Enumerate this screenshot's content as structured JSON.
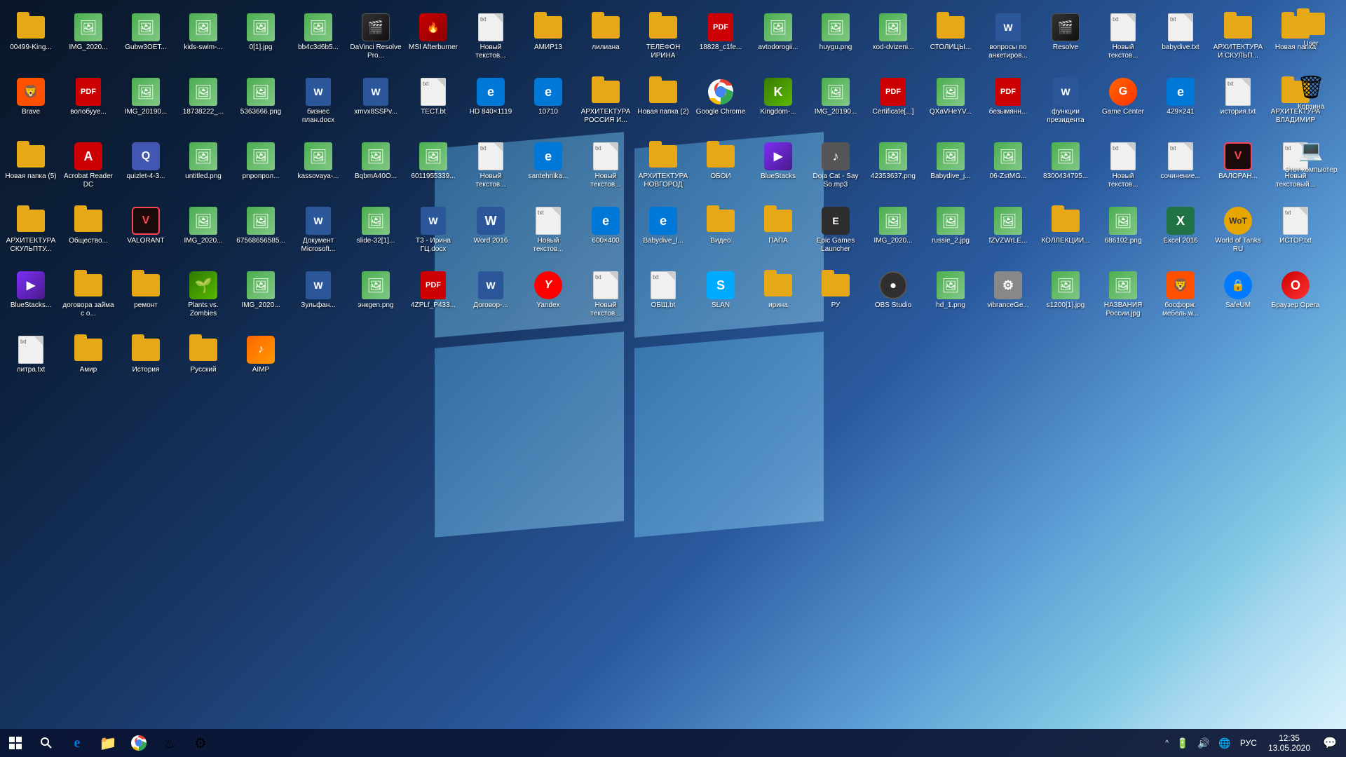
{
  "desktop": {
    "icons": [
      {
        "id": "00499-king",
        "label": "00499-King...",
        "type": "folder",
        "color": "#e6a817"
      },
      {
        "id": "img-2020-1",
        "label": "IMG_2020...",
        "type": "image"
      },
      {
        "id": "gubw3oet",
        "label": "Gubw3OET...",
        "type": "image"
      },
      {
        "id": "kids-swim",
        "label": "kids-swim-...",
        "type": "image"
      },
      {
        "id": "0-1-jpg",
        "label": "0[1].jpg",
        "type": "image"
      },
      {
        "id": "bb4c3d6b5",
        "label": "bb4c3d6b5...",
        "type": "image"
      },
      {
        "id": "davinci",
        "label": "DaVinci Resolve Pro...",
        "type": "app",
        "color": "#222",
        "symbol": "🎬"
      },
      {
        "id": "msi-afterburner",
        "label": "MSI Afterburner",
        "type": "app",
        "color": "#cc0000",
        "symbol": "🔥"
      },
      {
        "id": "novyi-txt-1",
        "label": "Новый текстов...",
        "type": "txt"
      },
      {
        "id": "amir13",
        "label": "АМИР13",
        "type": "folder",
        "color": "#e6a817"
      },
      {
        "id": "liliana",
        "label": "лилиана",
        "type": "folder",
        "color": "#e6a817"
      },
      {
        "id": "telefon-irina",
        "label": "ТЕЛЕФОН ИРИНА",
        "type": "folder",
        "color": "#e6a817"
      },
      {
        "id": "18828-c1fe",
        "label": "18828_c1fe...",
        "type": "pdf"
      },
      {
        "id": "avtodorogii",
        "label": "avtodorogii...",
        "type": "image"
      },
      {
        "id": "huygu-png",
        "label": "huygu.png",
        "type": "image"
      },
      {
        "id": "xod-dvizeni",
        "label": "xod-dvizeni...",
        "type": "image"
      },
      {
        "id": "stolitsy",
        "label": "СТОЛИЦЫ...",
        "type": "folder",
        "color": "#e6a817"
      },
      {
        "id": "voprosy-anketa",
        "label": "вопросы по анкетиров...",
        "type": "word"
      },
      {
        "id": "resolve",
        "label": "Resolve",
        "type": "app",
        "color": "#222",
        "symbol": "🎬"
      },
      {
        "id": "novyi-txt-2",
        "label": "Новый текстов...",
        "type": "txt"
      },
      {
        "id": "babydive-txt",
        "label": "babydive.txt",
        "type": "txt"
      },
      {
        "id": "arhitektura-skulp",
        "label": "АРХИТЕКТУРА И СКУЛЬП...",
        "type": "folder",
        "color": "#e6a817"
      },
      {
        "id": "novaya-papka-1",
        "label": "Новая папка",
        "type": "folder",
        "color": "#e6a817"
      },
      {
        "id": "brave",
        "label": "Brave",
        "type": "app",
        "color": "#ff5000",
        "symbol": "🦁"
      },
      {
        "id": "volobuye",
        "label": "волобуye...",
        "type": "pdf"
      },
      {
        "id": "img-2019-1",
        "label": "IMG_20190...",
        "type": "image"
      },
      {
        "id": "18738222",
        "label": "18738222_...",
        "type": "image"
      },
      {
        "id": "5363666",
        "label": "5363666.png",
        "type": "image"
      },
      {
        "id": "biznes-plan",
        "label": "бизнес план.docx",
        "type": "word"
      },
      {
        "id": "xmvx8sspv",
        "label": "xmvx8SSPv...",
        "type": "word"
      },
      {
        "id": "test-txt",
        "label": "ТЕСТ.bt",
        "type": "txt"
      },
      {
        "id": "hd-840",
        "label": "HD 840×1119",
        "type": "app",
        "color": "#0078d7",
        "symbol": "e"
      },
      {
        "id": "10710",
        "label": "10710",
        "type": "app",
        "color": "#0078d7",
        "symbol": "e"
      },
      {
        "id": "arhitektura-russia",
        "label": "АРХИТЕКТУРА РОССИЯ И...",
        "type": "folder",
        "color": "#e6a817"
      },
      {
        "id": "novaya-papka-2",
        "label": "Новая папка (2)",
        "type": "folder",
        "color": "#e6a817"
      },
      {
        "id": "google-chrome",
        "label": "Google Chrome",
        "type": "app",
        "color": "#fff",
        "symbol": "🌐"
      },
      {
        "id": "kingdom",
        "label": "Kingdom-...",
        "type": "app",
        "color": "#4caf50",
        "symbol": "K"
      },
      {
        "id": "img-2019-2",
        "label": "IMG_20190...",
        "type": "image"
      },
      {
        "id": "certificate",
        "label": "Certificate[...]",
        "type": "pdf"
      },
      {
        "id": "qxavheyv",
        "label": "QXaVHeYV...",
        "type": "image"
      },
      {
        "id": "bezymyannyi",
        "label": "безымянн...",
        "type": "pdf"
      },
      {
        "id": "funkcii-prezidenta",
        "label": "функции президента",
        "type": "word"
      },
      {
        "id": "game-center",
        "label": "Game Center",
        "type": "app",
        "color": "#ff6600",
        "symbol": "G"
      },
      {
        "id": "429x241",
        "label": "429×241",
        "type": "app",
        "color": "#0078d7",
        "symbol": "e"
      },
      {
        "id": "istoriya-txt",
        "label": "история.txt",
        "type": "txt"
      },
      {
        "id": "arhitektura-vladimir",
        "label": "АРХИТЕКТУРА ВЛАДИМИР",
        "type": "folder",
        "color": "#e6a817"
      },
      {
        "id": "novaya-papka-5",
        "label": "Новая папка (5)",
        "type": "folder",
        "color": "#e6a817"
      },
      {
        "id": "acrobat-reader",
        "label": "Acrobat Reader DC",
        "type": "app",
        "color": "#cc0000",
        "symbol": "A"
      },
      {
        "id": "quizlet",
        "label": "quizlet-4-3...",
        "type": "app",
        "color": "#4257b2",
        "symbol": "Q"
      },
      {
        "id": "untitled-png",
        "label": "untitled.png",
        "type": "image"
      },
      {
        "id": "pnroprol",
        "label": "pnропрол...",
        "type": "image"
      },
      {
        "id": "kassovaya",
        "label": "kassovaya-...",
        "type": "image"
      },
      {
        "id": "bqbma440",
        "label": "BqbmA40O...",
        "type": "image"
      },
      {
        "id": "6011955339",
        "label": "6011955339...",
        "type": "image"
      },
      {
        "id": "novyi-txt-3",
        "label": "Новый текстов...",
        "type": "txt"
      },
      {
        "id": "santehnika",
        "label": "santehnika...",
        "type": "app",
        "color": "#0078d7",
        "symbol": "e"
      },
      {
        "id": "novyi-txt-4",
        "label": "Новый текстов...",
        "type": "txt"
      },
      {
        "id": "arhitektura-novgorod",
        "label": "АРХИТЕКТУРА НОВГОРОД",
        "type": "folder",
        "color": "#e6a817"
      },
      {
        "id": "oboi",
        "label": "ОБОИ",
        "type": "folder",
        "color": "#e6a817"
      },
      {
        "id": "bluestacks",
        "label": "BlueStacks",
        "type": "app",
        "color": "#6a0dad",
        "symbol": "▶"
      },
      {
        "id": "doja-cat",
        "label": "Doja Cat - Say So.mp3",
        "type": "app",
        "color": "#555",
        "symbol": "♪"
      },
      {
        "id": "42353637",
        "label": "42353637.png",
        "type": "image"
      },
      {
        "id": "babydive-jpg",
        "label": "Babydive_j...",
        "type": "image"
      },
      {
        "id": "06-zstmg",
        "label": "06-ZstMG...",
        "type": "image"
      },
      {
        "id": "8300434795",
        "label": "8300434795...",
        "type": "image"
      },
      {
        "id": "novyi-txt-5",
        "label": "Новый текстов...",
        "type": "txt"
      },
      {
        "id": "sochinenie",
        "label": "сочинение...",
        "type": "txt"
      },
      {
        "id": "valorant-exe",
        "label": "ВАЛОРАН...",
        "type": "app",
        "color": "#ff4655",
        "symbol": "V"
      },
      {
        "id": "novyi-txt-6",
        "label": "Новый текстовый...",
        "type": "txt"
      },
      {
        "id": "arhitektura-skulp2",
        "label": "АРХИТЕКТУРА СКУЛЬПТУ...",
        "type": "folder",
        "color": "#e6a817"
      },
      {
        "id": "obschest",
        "label": "Общество...",
        "type": "folder",
        "color": "#e6a817"
      },
      {
        "id": "valorant",
        "label": "VALORANT",
        "type": "app",
        "color": "#ff4655",
        "symbol": "V"
      },
      {
        "id": "img-2020-2",
        "label": "IMG_2020...",
        "type": "image"
      },
      {
        "id": "67568656",
        "label": "67568656585...",
        "type": "image"
      },
      {
        "id": "dokument-ms",
        "label": "Документ Microsoft...",
        "type": "word"
      },
      {
        "id": "slide-32",
        "label": "slide-32[1]...",
        "type": "image"
      },
      {
        "id": "t3-irina",
        "label": "Т3 - Ирина ГЦ.docx",
        "type": "word"
      },
      {
        "id": "word-2016",
        "label": "Word 2016",
        "type": "app",
        "color": "#2b579a",
        "symbol": "W"
      },
      {
        "id": "novyi-txt-7",
        "label": "Новый текстов...",
        "type": "txt"
      },
      {
        "id": "600x400",
        "label": "600×400",
        "type": "app",
        "color": "#0078d7",
        "symbol": "e"
      },
      {
        "id": "babydive-l",
        "label": "Babydive_l...",
        "type": "app",
        "color": "#0078d7",
        "symbol": "e"
      },
      {
        "id": "video",
        "label": "Видео",
        "type": "folder",
        "color": "#e6a817"
      },
      {
        "id": "papa",
        "label": "ПАПА",
        "type": "folder",
        "color": "#e6a817"
      },
      {
        "id": "epic-games",
        "label": "Epic Games Launcher",
        "type": "app",
        "color": "#222",
        "symbol": "E"
      },
      {
        "id": "img-2020-3",
        "label": "IMG_2020...",
        "type": "image"
      },
      {
        "id": "russie-2",
        "label": "russie_2.jpg",
        "type": "image"
      },
      {
        "id": "fzvzwrle",
        "label": "fZVZWrLE...",
        "type": "image"
      },
      {
        "id": "kollekcii",
        "label": "КОЛЛЕКЦИИ...",
        "type": "folder",
        "color": "#e6a817"
      },
      {
        "id": "686102",
        "label": "686102.png",
        "type": "image"
      },
      {
        "id": "excel-2016",
        "label": "Excel 2016",
        "type": "app",
        "color": "#217346",
        "symbol": "X"
      },
      {
        "id": "world-of-tanks",
        "label": "World of Tanks RU",
        "type": "app",
        "color": "#333",
        "symbol": "🎮"
      },
      {
        "id": "istor-txt",
        "label": "ИСТОР.txt",
        "type": "txt"
      },
      {
        "id": "bluestacks-exe",
        "label": "BlueStacks...",
        "type": "app",
        "color": "#6a0dad",
        "symbol": "▶"
      },
      {
        "id": "dogovor-zayma",
        "label": "договора займа с о...",
        "type": "folder",
        "color": "#e6a817"
      },
      {
        "id": "remont",
        "label": "ремонт",
        "type": "folder",
        "color": "#e6a817"
      },
      {
        "id": "plants-vs-zombies",
        "label": "Plants vs. Zombies",
        "type": "app",
        "color": "#4caf50",
        "symbol": "🌱"
      },
      {
        "id": "img-2020-4",
        "label": "IMG_2020...",
        "type": "image"
      },
      {
        "id": "zulfan",
        "label": "Зульфан...",
        "type": "word"
      },
      {
        "id": "enkgen",
        "label": "энкgen.png",
        "type": "image"
      },
      {
        "id": "4zplf-p433",
        "label": "4ZPLf_P433...",
        "type": "pdf"
      },
      {
        "id": "dogovor",
        "label": "Договор-...",
        "type": "word"
      },
      {
        "id": "yandex",
        "label": "Yandex",
        "type": "app",
        "color": "#ff0000",
        "symbol": "Y"
      },
      {
        "id": "novyi-txt-8",
        "label": "Новый текстов...",
        "type": "txt"
      },
      {
        "id": "obsch-txt",
        "label": "ОБЩ.bt",
        "type": "txt"
      },
      {
        "id": "slan",
        "label": "SLAN",
        "type": "app",
        "color": "#00aaff",
        "symbol": "S"
      },
      {
        "id": "irina",
        "label": "ирина",
        "type": "folder",
        "color": "#e6a817"
      },
      {
        "id": "ru",
        "label": "РУ",
        "type": "folder",
        "color": "#e6a817"
      },
      {
        "id": "obs-studio",
        "label": "OBS Studio",
        "type": "app",
        "color": "#302e31",
        "symbol": "⏺"
      },
      {
        "id": "hd-1",
        "label": "hd_1.png",
        "type": "image"
      },
      {
        "id": "vibrancege",
        "label": "vibranceGe...",
        "type": "app",
        "color": "#888",
        "symbol": "⚙"
      },
      {
        "id": "s1200-1",
        "label": "s1200[1].jpg",
        "type": "image"
      },
      {
        "id": "nazvaniya-rossii",
        "label": "НАЗВАНИЯ России.jpg",
        "type": "image"
      },
      {
        "id": "bosforzh",
        "label": "босфорж. мебель.w...",
        "type": "app",
        "color": "#ff5000",
        "symbol": "🦁"
      },
      {
        "id": "safeUM",
        "label": "SafeUM",
        "type": "app",
        "color": "#007bff",
        "symbol": "🔒"
      },
      {
        "id": "brauser-opera",
        "label": "Браузер Opera",
        "type": "app",
        "color": "#cc0000",
        "symbol": "O"
      },
      {
        "id": "litra-txt",
        "label": "литра.txt",
        "type": "txt"
      },
      {
        "id": "amir",
        "label": "Амир",
        "type": "folder",
        "color": "#e6a817"
      },
      {
        "id": "istoriya",
        "label": "История",
        "type": "folder",
        "color": "#e6a817"
      },
      {
        "id": "russkiy",
        "label": "Русский",
        "type": "folder",
        "color": "#e6a817"
      },
      {
        "id": "aimp",
        "label": "AIMP",
        "type": "app",
        "color": "#ff6600",
        "symbol": "♪"
      }
    ],
    "right_icons": [
      {
        "id": "user",
        "label": "User",
        "type": "folder",
        "color": "#e6a817"
      },
      {
        "id": "korzina",
        "label": "Корзина",
        "type": "app",
        "color": "#777",
        "symbol": "🗑"
      },
      {
        "id": "etot-komputer",
        "label": "Этот компьютер",
        "type": "app",
        "color": "#4fc3f7",
        "symbol": "💻"
      }
    ]
  },
  "taskbar": {
    "start_label": "⊞",
    "search_label": "🔍",
    "apps": [
      {
        "id": "edge",
        "label": "Edge",
        "symbol": "e",
        "color": "#0078d7",
        "active": false
      },
      {
        "id": "file-explorer",
        "label": "File Explorer",
        "symbol": "📁",
        "color": "#e6a817",
        "active": false
      },
      {
        "id": "chrome",
        "label": "Chrome",
        "symbol": "🌐",
        "active": false
      },
      {
        "id": "steam",
        "label": "Steam",
        "symbol": "♨",
        "color": "#1b2838",
        "active": false
      },
      {
        "id": "settings",
        "label": "Settings",
        "symbol": "⚙",
        "active": false
      }
    ],
    "tray": {
      "chevron": "^",
      "icons": [
        "🔋",
        "🔊",
        "🌐"
      ],
      "language": "РУС",
      "time": "12:35",
      "date": "13.05.2020",
      "notification": "🗨"
    }
  }
}
